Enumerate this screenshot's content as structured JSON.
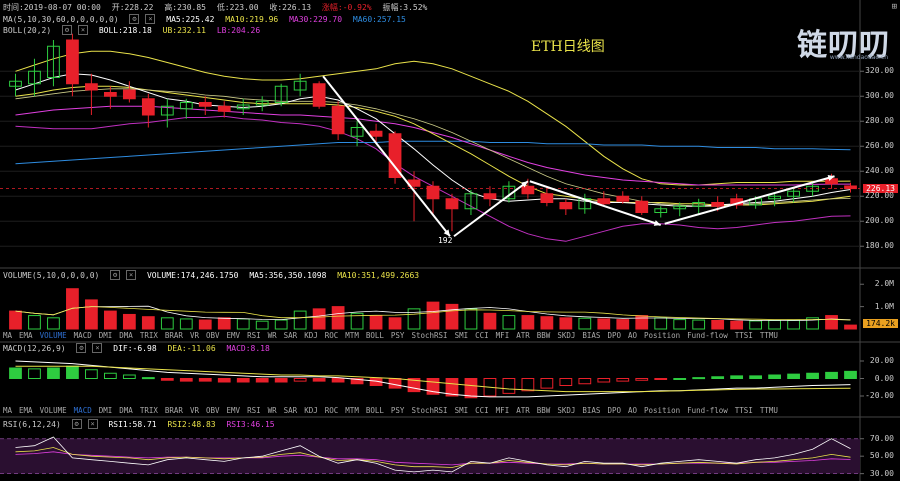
{
  "header": {
    "time_label": "时间:2019-08-07 00:00",
    "open_label": "开:228.22",
    "high_label": "高:230.85",
    "low_label": "低:223.00",
    "close_label": "收:226.13",
    "change_label": "涨幅:-0.92%",
    "amplitude_label": "振幅:3.52%"
  },
  "ma_header": {
    "label": "MA(5,10,30,60,0,0,0,0,0)",
    "ma5": "MA5:225.42",
    "ma10": "MA10:219.96",
    "ma30": "MA30:229.70",
    "ma60": "MA60:257.15"
  },
  "boll_header": {
    "label": "BOLL(20,2)",
    "boll": "BOLL:218.18",
    "ub": "UB:232.11",
    "lb": "LB:204.26"
  },
  "volume_header": {
    "label": "VOLUME(5,10,0,0,0,0)",
    "volume": "VOLUME:174,246.1750",
    "ma5": "MA5:356,350.1098",
    "ma10": "MA10:351,499.2663"
  },
  "macd_header": {
    "label": "MACD(12,26,9)",
    "dif": "DIF:-6.98",
    "dea": "DEA:-11.06",
    "macd": "MACD:8.18"
  },
  "rsi_header": {
    "label": "RSI(6,12,24)",
    "rsi1": "RSI1:58.71",
    "rsi2": "RSI2:48.83",
    "rsi3": "RSI3:46.15"
  },
  "indicator_tabs": [
    "MA",
    "EMA",
    "VOLUME",
    "MACD",
    "DMI",
    "DMA",
    "TRIX",
    "BRAR",
    "VR",
    "OBV",
    "EMV",
    "RSI",
    "WR",
    "SAR",
    "KDJ",
    "ROC",
    "MTM",
    "BOLL",
    "PSY",
    "StochRSI",
    "SMI",
    "CCI",
    "MFI",
    "ATR",
    "BBW",
    "SKDJ",
    "BIAS",
    "DPO",
    "AO",
    "Position",
    "Fund-flow",
    "TTSI",
    "TTMU"
  ],
  "chart_title": "ETH日线图",
  "logo_text": "链叨叨",
  "logo_sub": "www.liandaodao.cn",
  "last_price_tag": "226.13",
  "last_volume_tag": "174.2k",
  "low_marker": "192",
  "colors": {
    "up": "#2ecc40",
    "down": "#e8202a",
    "ma5": "#ffffff",
    "ma10": "#e9e24a",
    "ma30": "#e040e0",
    "ma60": "#2e8ce0",
    "boll_band": "#e9e24a",
    "boll_lb": "#c030c0"
  },
  "chart_data": [
    {
      "type": "candlestick",
      "name": "price",
      "y_axis_ticks": [
        180,
        200,
        220,
        240,
        260,
        280,
        300,
        320
      ],
      "ylim": [
        165,
        345
      ],
      "candles": [
        {
          "o": 308,
          "h": 318,
          "l": 300,
          "c": 312
        },
        {
          "o": 310,
          "h": 330,
          "l": 300,
          "c": 320
        },
        {
          "o": 315,
          "h": 345,
          "l": 308,
          "c": 340
        },
        {
          "o": 345,
          "h": 350,
          "l": 300,
          "c": 310
        },
        {
          "o": 310,
          "h": 318,
          "l": 285,
          "c": 305
        },
        {
          "o": 303,
          "h": 308,
          "l": 290,
          "c": 300
        },
        {
          "o": 305,
          "h": 312,
          "l": 295,
          "c": 298
        },
        {
          "o": 298,
          "h": 302,
          "l": 275,
          "c": 285
        },
        {
          "o": 285,
          "h": 298,
          "l": 275,
          "c": 292
        },
        {
          "o": 290,
          "h": 298,
          "l": 282,
          "c": 295
        },
        {
          "o": 295,
          "h": 300,
          "l": 285,
          "c": 292
        },
        {
          "o": 292,
          "h": 296,
          "l": 283,
          "c": 288
        },
        {
          "o": 290,
          "h": 298,
          "l": 285,
          "c": 293
        },
        {
          "o": 293,
          "h": 300,
          "l": 288,
          "c": 296
        },
        {
          "o": 295,
          "h": 310,
          "l": 292,
          "c": 308
        },
        {
          "o": 305,
          "h": 318,
          "l": 300,
          "c": 312
        },
        {
          "o": 310,
          "h": 312,
          "l": 290,
          "c": 292
        },
        {
          "o": 292,
          "h": 296,
          "l": 265,
          "c": 270
        },
        {
          "o": 268,
          "h": 280,
          "l": 260,
          "c": 275
        },
        {
          "o": 272,
          "h": 278,
          "l": 262,
          "c": 268
        },
        {
          "o": 270,
          "h": 272,
          "l": 230,
          "c": 235
        },
        {
          "o": 233,
          "h": 240,
          "l": 200,
          "c": 228
        },
        {
          "o": 228,
          "h": 232,
          "l": 205,
          "c": 218
        },
        {
          "o": 218,
          "h": 222,
          "l": 192,
          "c": 210
        },
        {
          "o": 210,
          "h": 225,
          "l": 205,
          "c": 222
        },
        {
          "o": 222,
          "h": 228,
          "l": 212,
          "c": 218
        },
        {
          "o": 218,
          "h": 232,
          "l": 215,
          "c": 228
        },
        {
          "o": 228,
          "h": 234,
          "l": 218,
          "c": 222
        },
        {
          "o": 222,
          "h": 226,
          "l": 212,
          "c": 215
        },
        {
          "o": 215,
          "h": 218,
          "l": 205,
          "c": 210
        },
        {
          "o": 210,
          "h": 222,
          "l": 206,
          "c": 218
        },
        {
          "o": 218,
          "h": 224,
          "l": 212,
          "c": 214
        },
        {
          "o": 220,
          "h": 224,
          "l": 214,
          "c": 216
        },
        {
          "o": 216,
          "h": 220,
          "l": 205,
          "c": 207
        },
        {
          "o": 207,
          "h": 212,
          "l": 203,
          "c": 210
        },
        {
          "o": 210,
          "h": 215,
          "l": 204,
          "c": 212
        },
        {
          "o": 212,
          "h": 218,
          "l": 205,
          "c": 215
        },
        {
          "o": 215,
          "h": 220,
          "l": 208,
          "c": 212
        },
        {
          "o": 218,
          "h": 222,
          "l": 210,
          "c": 213
        },
        {
          "o": 213,
          "h": 220,
          "l": 210,
          "c": 218
        },
        {
          "o": 218,
          "h": 222,
          "l": 212,
          "c": 220
        },
        {
          "o": 220,
          "h": 226,
          "l": 215,
          "c": 224
        },
        {
          "o": 224,
          "h": 232,
          "l": 220,
          "c": 228
        },
        {
          "o": 234,
          "h": 238,
          "l": 226,
          "c": 230
        },
        {
          "o": 228.22,
          "h": 230.85,
          "l": 223.0,
          "c": 226.13
        }
      ],
      "ma5": [
        305,
        310,
        315,
        318,
        317,
        313,
        308,
        303,
        298,
        296,
        293,
        292,
        291,
        292,
        294,
        298,
        300,
        297,
        290,
        282,
        270,
        258,
        245,
        233,
        223,
        218,
        216,
        217,
        218,
        218,
        216,
        215,
        215,
        214,
        213,
        212,
        212,
        213,
        214,
        215,
        216,
        218,
        220,
        223,
        225.42
      ],
      "ma10": [
        300,
        302,
        305,
        307,
        308,
        308,
        307,
        305,
        303,
        301,
        299,
        297,
        295,
        294,
        294,
        294,
        294,
        293,
        291,
        288,
        284,
        278,
        270,
        262,
        254,
        245,
        236,
        228,
        222,
        220,
        218,
        216,
        215,
        215,
        215,
        214,
        214,
        213,
        213,
        213,
        214,
        215,
        216,
        218,
        219.96
      ],
      "ma30": [
        285,
        287,
        289,
        290,
        291,
        292,
        292,
        292,
        291,
        290,
        289,
        288,
        287,
        286,
        285,
        285,
        284,
        283,
        282,
        280,
        278,
        275,
        271,
        267,
        262,
        257,
        252,
        247,
        243,
        240,
        237,
        235,
        233,
        232,
        231,
        230,
        229,
        229,
        229,
        229,
        229,
        229,
        229.5,
        229.7,
        229.7
      ],
      "ma60": [
        246,
        247,
        248,
        249,
        250,
        251,
        252,
        253,
        254,
        255,
        256,
        257,
        258,
        259,
        260,
        261,
        262,
        263,
        263,
        263,
        264,
        264,
        264,
        264,
        264,
        263,
        263,
        263,
        262,
        262,
        262,
        261,
        261,
        261,
        260,
        260,
        260,
        259,
        259,
        259,
        258,
        258,
        258,
        257.5,
        257.15
      ],
      "boll_ub": [
        320,
        325,
        330,
        334,
        336,
        336,
        334,
        331,
        327,
        323,
        319,
        316,
        314,
        313,
        313,
        314,
        316,
        318,
        320,
        322,
        326,
        328,
        326,
        322,
        316,
        310,
        304,
        296,
        286,
        276,
        264,
        252,
        242,
        234,
        230,
        229,
        229,
        230,
        231,
        231,
        231,
        232,
        232,
        232,
        232.11
      ],
      "boll_mid": [
        298,
        300,
        302,
        304,
        305,
        306,
        306,
        305,
        304,
        303,
        301,
        300,
        298,
        297,
        296,
        296,
        296,
        295,
        293,
        290,
        286,
        282,
        277,
        271,
        264,
        257,
        250,
        243,
        236,
        230,
        226,
        222,
        219,
        216,
        214,
        213,
        212,
        212,
        213,
        214,
        215,
        216,
        217,
        218,
        218.18
      ],
      "boll_lb": [
        276,
        275,
        274,
        274,
        274,
        276,
        278,
        279,
        281,
        283,
        283,
        284,
        282,
        281,
        279,
        278,
        276,
        272,
        266,
        258,
        246,
        236,
        228,
        220,
        212,
        204,
        196,
        190,
        186,
        184,
        188,
        192,
        196,
        198,
        198,
        197,
        195,
        194,
        195,
        197,
        199,
        200,
        202,
        204,
        204.26
      ],
      "y_axis_labels": [
        "320.00",
        "300.00",
        "280.00",
        "260.00",
        "240.00",
        "220.00",
        "200.00",
        "180.00"
      ]
    },
    {
      "type": "bar",
      "name": "volume",
      "y_axis_labels": [
        "2.0M",
        "1.0M"
      ],
      "ylim": [
        0,
        2100000
      ],
      "values": [
        800000,
        600000,
        500000,
        1800000,
        1300000,
        800000,
        650000,
        550000,
        500000,
        450000,
        400000,
        500000,
        450000,
        350000,
        400000,
        800000,
        900000,
        1000000,
        700000,
        600000,
        500000,
        900000,
        1200000,
        1100000,
        900000,
        700000,
        600000,
        600000,
        550000,
        500000,
        480000,
        450000,
        420000,
        600000,
        500000,
        420000,
        400000,
        380000,
        350000,
        360000,
        380000,
        400000,
        500000,
        600000,
        174246
      ],
      "up_flags": [
        false,
        true,
        true,
        false,
        false,
        false,
        false,
        false,
        true,
        true,
        false,
        false,
        true,
        true,
        true,
        true,
        false,
        false,
        true,
        false,
        false,
        true,
        false,
        false,
        true,
        false,
        true,
        false,
        false,
        false,
        true,
        false,
        false,
        false,
        true,
        true,
        true,
        false,
        false,
        true,
        true,
        true,
        true,
        false,
        false
      ]
    },
    {
      "type": "bar",
      "name": "macd",
      "y_axis_labels": [
        "20.00",
        "0.00",
        "-20.00"
      ],
      "ylim": [
        -28,
        28
      ],
      "hist": [
        12,
        11,
        12,
        14,
        10,
        6,
        4,
        1,
        -2,
        -3,
        -3,
        -4,
        -4,
        -4,
        -4,
        -3,
        -3,
        -4,
        -6,
        -8,
        -11,
        -15,
        -18,
        -20,
        -22,
        -20,
        -17,
        -14,
        -11,
        -8,
        -6,
        -4,
        -3,
        -2,
        -1,
        0,
        1,
        2,
        3,
        3,
        4,
        5,
        6,
        7,
        8.18
      ],
      "dif": [
        20,
        19,
        18,
        17,
        15,
        13,
        11,
        9,
        7,
        6,
        5,
        4,
        3,
        2,
        2,
        2,
        2,
        1,
        -1,
        -3,
        -7,
        -11,
        -15,
        -18,
        -20,
        -21,
        -21,
        -21,
        -20,
        -19,
        -18,
        -17,
        -16,
        -15,
        -14,
        -14,
        -13,
        -12,
        -11,
        -11,
        -10,
        -9,
        -8,
        -7.5,
        -6.98
      ],
      "dea": [
        14,
        14,
        14,
        14,
        14,
        13,
        12,
        11,
        10,
        9,
        8,
        7,
        6,
        5,
        4,
        4,
        3,
        3,
        2,
        1,
        0,
        -2,
        -4,
        -6,
        -8,
        -10,
        -12,
        -13,
        -14,
        -15,
        -15,
        -15,
        -15,
        -15,
        -14.5,
        -14,
        -13.5,
        -13,
        -12.5,
        -12,
        -12,
        -11.8,
        -11.5,
        -11.3,
        -11.06
      ]
    },
    {
      "type": "line",
      "name": "rsi",
      "y_axis_labels": [
        "70.00",
        "50.00",
        "30.00"
      ],
      "ylim": [
        25,
        80
      ],
      "rsi1": [
        60,
        62,
        72,
        48,
        46,
        44,
        42,
        40,
        46,
        48,
        46,
        44,
        48,
        50,
        56,
        62,
        50,
        42,
        46,
        42,
        34,
        32,
        34,
        32,
        44,
        42,
        48,
        44,
        40,
        38,
        44,
        42,
        42,
        38,
        42,
        44,
        46,
        44,
        42,
        46,
        48,
        52,
        58,
        70,
        58.71
      ],
      "rsi2": [
        55,
        56,
        60,
        52,
        50,
        49,
        48,
        46,
        48,
        49,
        48,
        47,
        48,
        49,
        52,
        54,
        49,
        45,
        46,
        44,
        40,
        38,
        38,
        37,
        42,
        42,
        45,
        43,
        41,
        40,
        42,
        41,
        41,
        40,
        41,
        42,
        43,
        42,
        41,
        43,
        44,
        46,
        48,
        52,
        48.83
      ],
      "rsi3": [
        52,
        53,
        55,
        52,
        51,
        50,
        49,
        48,
        49,
        49,
        48,
        48,
        48,
        48,
        50,
        51,
        49,
        47,
        47,
        46,
        43,
        42,
        41,
        40,
        42,
        42,
        43,
        42,
        41,
        41,
        42,
        41,
        41,
        41,
        41,
        42,
        42,
        42,
        42,
        43,
        43,
        44,
        45,
        47,
        46.15
      ]
    }
  ]
}
